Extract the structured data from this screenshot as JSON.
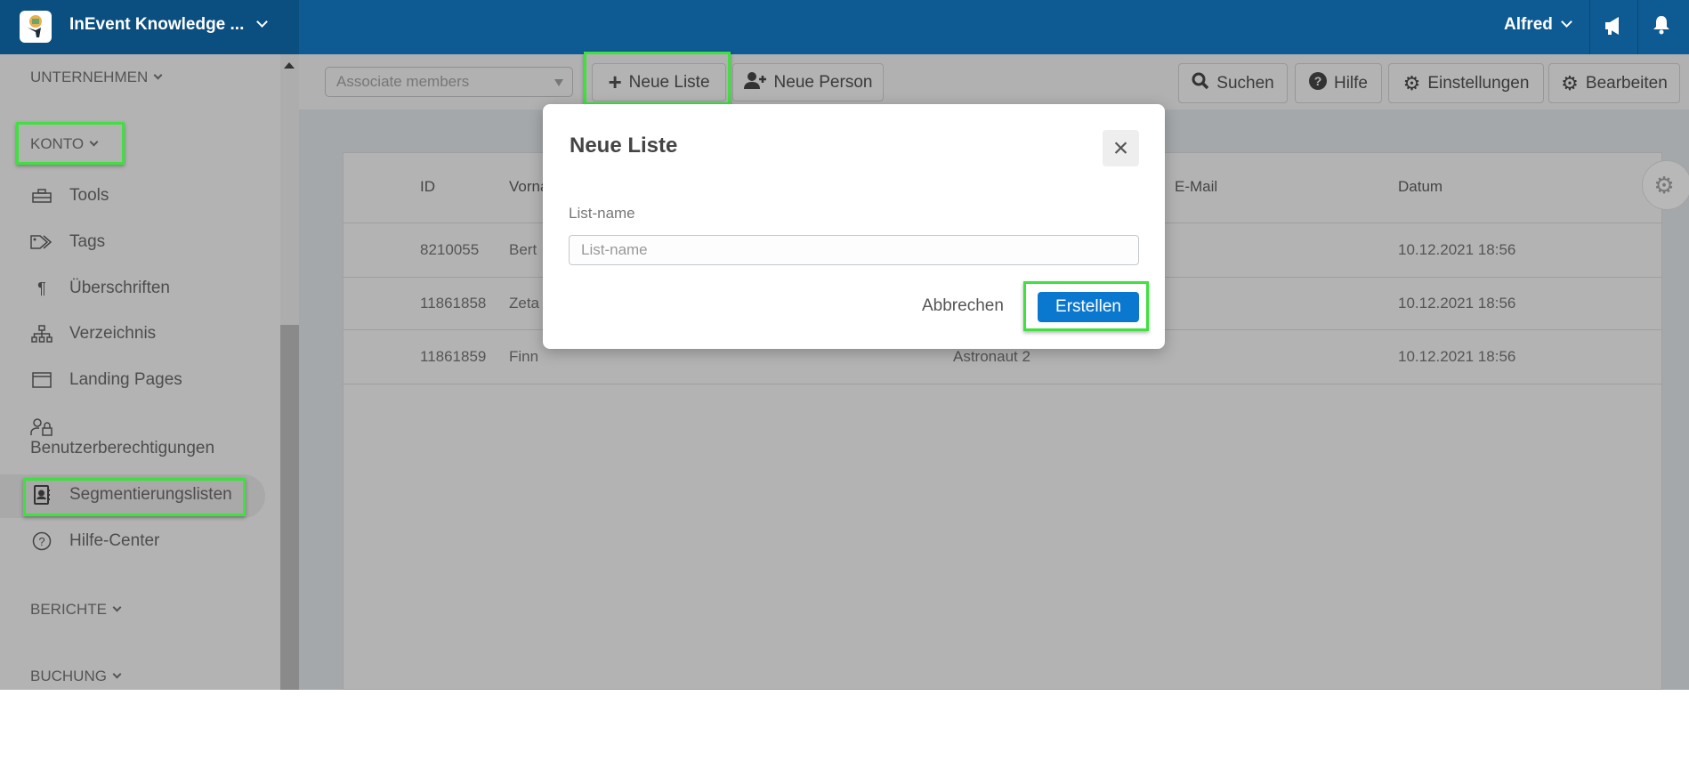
{
  "header": {
    "title": "InEvent Knowledge ...",
    "user": "Alfred"
  },
  "sidebar": {
    "sections": {
      "unternehmen": "UNTERNEHMEN",
      "konto": "KONTO",
      "berichte": "BERICHTE",
      "buchung": "BUCHUNG"
    },
    "items": [
      {
        "label": "Tools",
        "icon": "toolbox-icon"
      },
      {
        "label": "Tags",
        "icon": "tags-icon"
      },
      {
        "label": "Überschriften",
        "icon": "paragraph-icon"
      },
      {
        "label": "Verzeichnis",
        "icon": "sitemap-icon"
      },
      {
        "label": "Landing Pages",
        "icon": "window-icon"
      },
      {
        "label": "Benutzerberechtigungen",
        "icon": "user-lock-icon"
      },
      {
        "label": "Segmentierungslisten",
        "icon": "address-book-icon",
        "active": true
      },
      {
        "label": "Hilfe-Center",
        "icon": "question-circle-icon"
      }
    ]
  },
  "toolbar": {
    "select_value": "Associate members",
    "new_list": "Neue Liste",
    "new_person": "Neue Person",
    "search": "Suchen",
    "help": "Hilfe",
    "settings": "Einstellungen",
    "edit": "Bearbeiten"
  },
  "table": {
    "headers": [
      "ID",
      "Vorna",
      "E-Mail",
      "Datum"
    ],
    "rows": [
      {
        "id": "8210055",
        "first": "Bert",
        "last": "",
        "date": "10.12.2021 18:56"
      },
      {
        "id": "11861858",
        "first": "Zeta",
        "last": "",
        "date": "10.12.2021 18:56"
      },
      {
        "id": "11861859",
        "first": "Finn",
        "last": "Astronaut 2",
        "date": "10.12.2021 18:56"
      }
    ]
  },
  "modal": {
    "title": "Neue Liste",
    "label": "List-name",
    "placeholder": "List-name",
    "value": "",
    "cancel": "Abbrechen",
    "create": "Erstellen"
  },
  "colors": {
    "topbar": "#0e5a92",
    "primary_button": "#0b78d0",
    "highlight": "#3fe03f"
  }
}
